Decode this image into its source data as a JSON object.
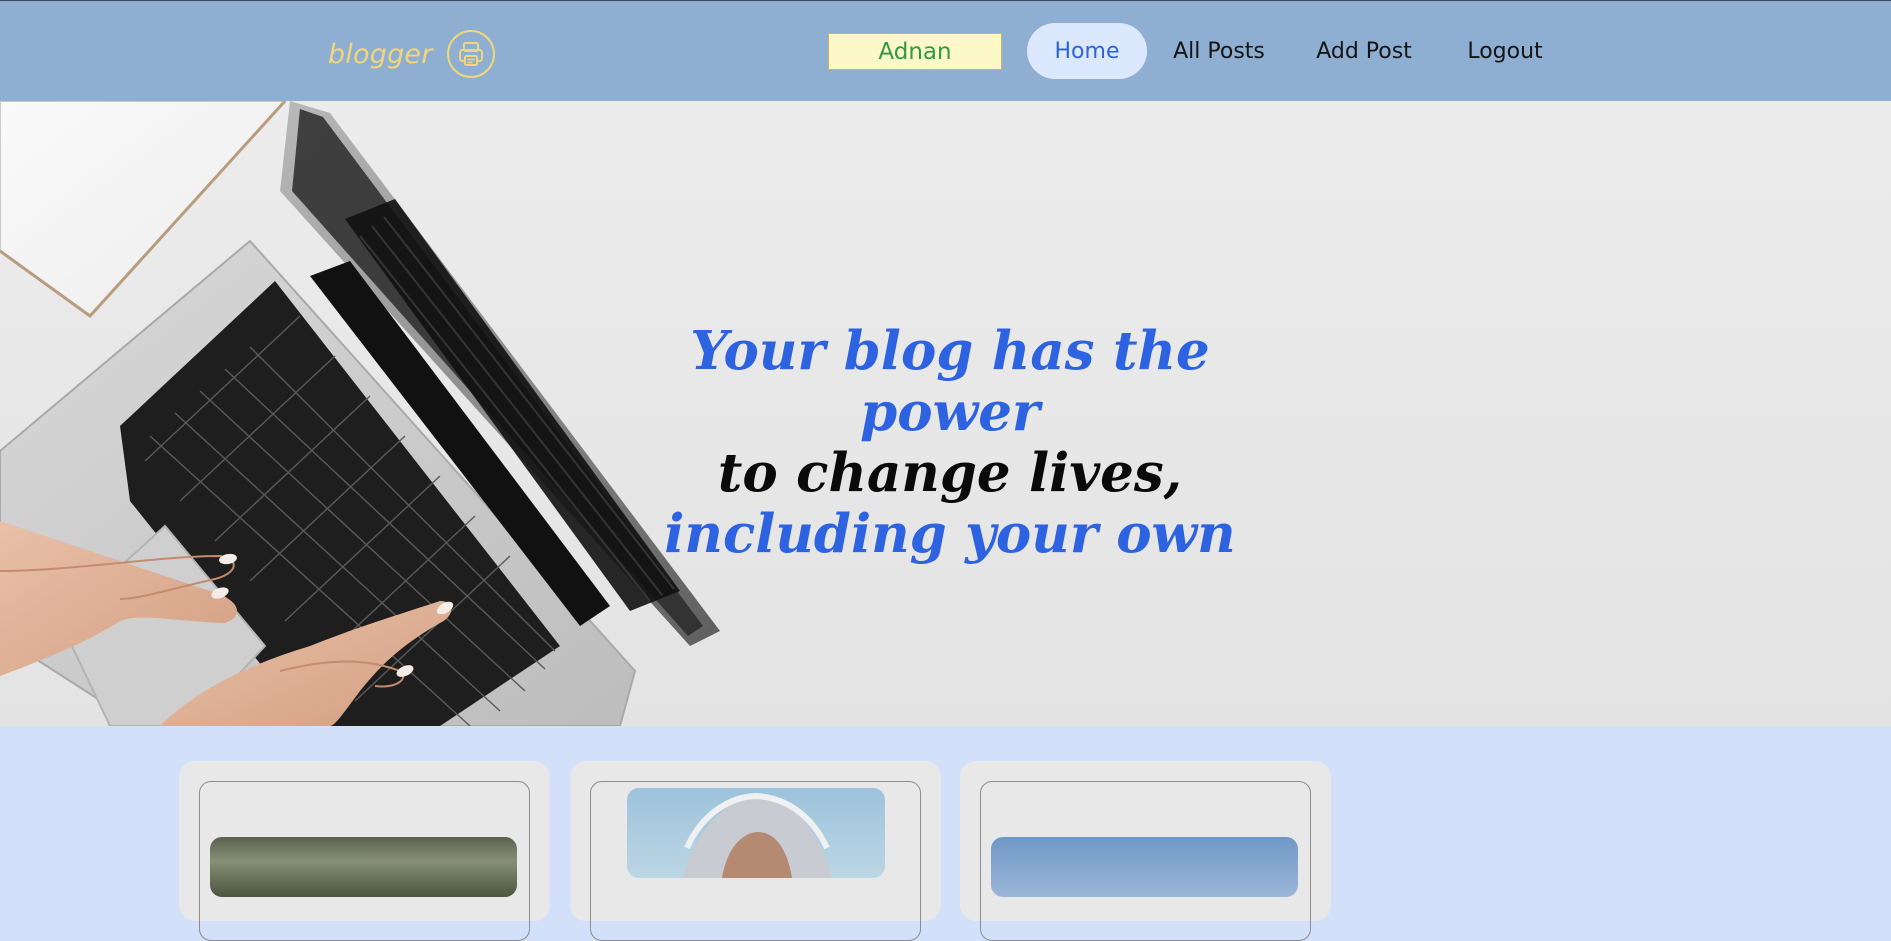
{
  "nav": {
    "brand": "blogger",
    "brand_icon": "printer-icon",
    "username": "Adnan",
    "items": [
      {
        "label": "Home",
        "active": true
      },
      {
        "label": "All Posts",
        "active": false
      },
      {
        "label": "Add Post",
        "active": false
      },
      {
        "label": "Logout",
        "active": false
      }
    ]
  },
  "hero": {
    "lines": [
      "Your blog has the power",
      "to change lives,",
      "including your own"
    ],
    "image": "laptop-typing-hands"
  },
  "cards": [
    {
      "image": "landscape-thumbnail"
    },
    {
      "image": "portrait-thumbnail"
    },
    {
      "image": "sky-thumbnail"
    }
  ],
  "colors": {
    "nav_bg": "#8eaed2",
    "brand": "#f1d67a",
    "accent_blue": "#2d62e0",
    "username_text": "#2f9a47",
    "username_bg": "#fdf8c8",
    "page_bg": "#d3e0fa"
  }
}
